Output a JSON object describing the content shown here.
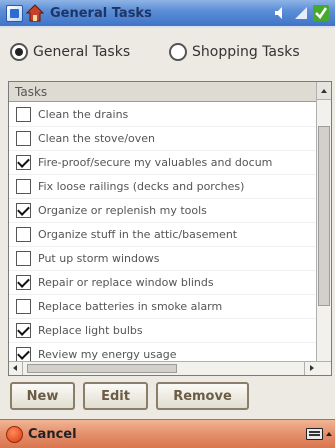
{
  "titlebar": {
    "title": "General Tasks"
  },
  "filter": {
    "options": [
      {
        "label": "General Tasks",
        "selected": true
      },
      {
        "label": "Shopping Tasks",
        "selected": false
      }
    ]
  },
  "list": {
    "header": "Tasks",
    "items": [
      {
        "label": "Clean the drains",
        "checked": false
      },
      {
        "label": "Clean the stove/oven",
        "checked": false
      },
      {
        "label": "Fire-proof/secure my valuables and docum",
        "checked": true
      },
      {
        "label": "Fix loose railings (decks and porches)",
        "checked": false
      },
      {
        "label": "Organize or replenish my tools",
        "checked": true
      },
      {
        "label": "Organize stuff in the attic/basement",
        "checked": false
      },
      {
        "label": "Put up storm windows",
        "checked": false
      },
      {
        "label": "Repair or replace window blinds",
        "checked": true
      },
      {
        "label": "Replace batteries in smoke alarm",
        "checked": false
      },
      {
        "label": "Replace light bulbs",
        "checked": true
      },
      {
        "label": "Review my energy usage",
        "checked": true
      }
    ]
  },
  "buttons": {
    "new": "New",
    "edit": "Edit",
    "remove": "Remove"
  },
  "menubar": {
    "cancel": "Cancel"
  },
  "colors": {
    "title_bar": "#3f74c7",
    "menu_bar": "#d9764f"
  },
  "icons": [
    "windows-start-icon",
    "home-app-icon",
    "speaker-icon",
    "signal-icon",
    "ok-check-icon",
    "keyboard-icon"
  ]
}
